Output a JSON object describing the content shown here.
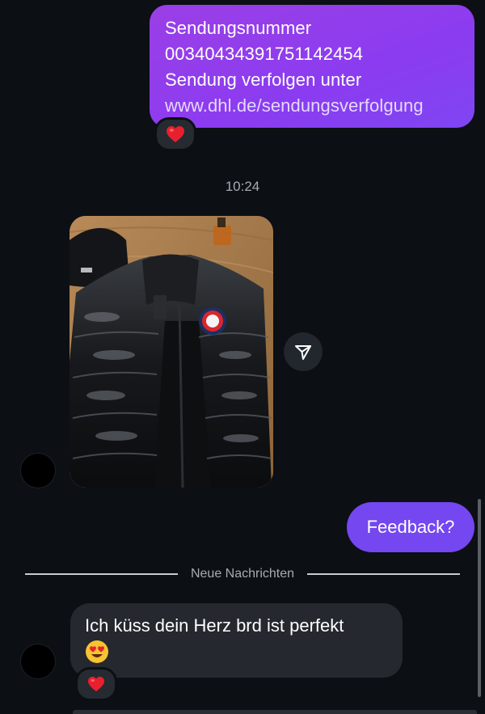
{
  "messages": {
    "outgoing_1": {
      "line1": "Sendungsnummer",
      "line2": "00340434391751142454",
      "line3": "Sendung verfolgen unter",
      "line4": "www.dhl.de/sendungsverfolgung",
      "reaction": "heart"
    },
    "timestamp": "10:24",
    "outgoing_2": {
      "text": "Feedback?"
    },
    "divider_label": "Neue Nachrichten",
    "incoming_1": {
      "text": "Ich küss dein Herz brd ist perfekt",
      "emoji": "heart-eyes",
      "reaction": "heart"
    }
  },
  "icons": {
    "reaction": "heart-icon",
    "share": "send-icon",
    "emoji": "heart-eyes-emoji"
  },
  "colors": {
    "background": "#0c0f14",
    "outgoing_gradient_start": "#9b3fe6",
    "outgoing_gradient_end": "#7f45f2",
    "outgoing_solid": "#7447f0",
    "incoming_bubble": "#25282e",
    "heart": "#e8202e"
  }
}
